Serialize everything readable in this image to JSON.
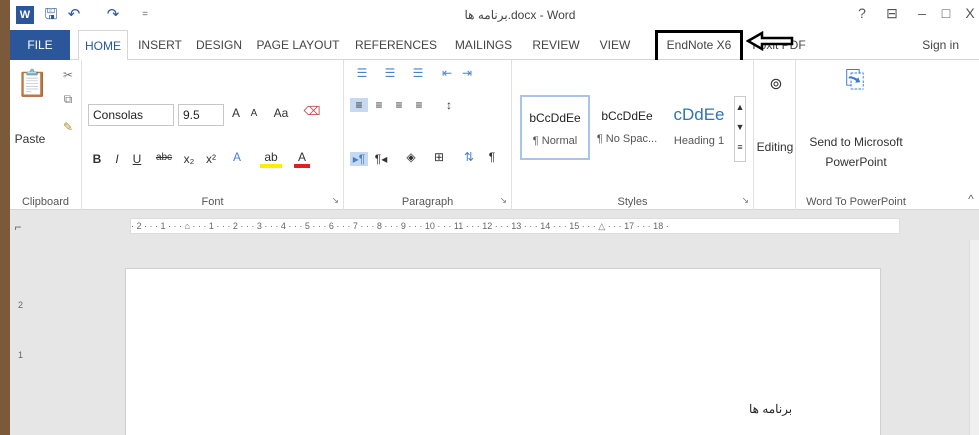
{
  "window": {
    "title": "برنامه ها.docx - Word",
    "help": "?",
    "ribbon_display": "⊟",
    "minimize": "–",
    "maximize": "□",
    "close": "X"
  },
  "qat": {
    "word_icon": "W",
    "more": "="
  },
  "tabs": [
    "FILE",
    "HOME",
    "INSERT",
    "DESIGN",
    "PAGE LAYOUT",
    "REFERENCES",
    "MAILINGS",
    "REVIEW",
    "VIEW",
    "EndNote X6",
    "Foxit PDF"
  ],
  "signin": "Sign in",
  "clipboard": {
    "paste": "Paste",
    "label": "Clipboard"
  },
  "font": {
    "name": "Consolas",
    "size": "9.5",
    "grow": "A",
    "shrink": "A",
    "case": "Aa",
    "bold": "B",
    "italic": "I",
    "underline": "U",
    "strike": "abc",
    "subscript": "x₂",
    "superscript": "x²",
    "effects": "A",
    "highlight": "ab",
    "color": "A",
    "label": "Font"
  },
  "paragraph": {
    "label": "Paragraph",
    "pilcrow": "¶"
  },
  "styles": {
    "items": [
      {
        "sample": "bCcDdEe",
        "name": "¶ Normal"
      },
      {
        "sample": "bCcDdEe",
        "name": "¶ No Spac..."
      },
      {
        "sample": "cDdEe",
        "name": "Heading 1"
      }
    ],
    "label": "Styles"
  },
  "editing": {
    "label": "Editing"
  },
  "word_to_pp": {
    "button": "Send to Microsoft PowerPoint",
    "label": "Word To PowerPoint"
  },
  "ruler_text": "· 2 · · · 1 · · · ⌂ · · · 1 · · · 2 · · · 3 · · · 4 · · · 5 · · · 6 · · · 7 · · · 8 · · · 9 · · · 10 · · · 11 · · · 12 · · · 13 · · · 14 · · · 15 · · · △ · · · 17 · · · 18 ·",
  "vruler": [
    "2",
    "1"
  ],
  "document": {
    "text": "برنامه ها"
  },
  "colors": {
    "accent": "#2b579a",
    "annotation": "#000000"
  }
}
